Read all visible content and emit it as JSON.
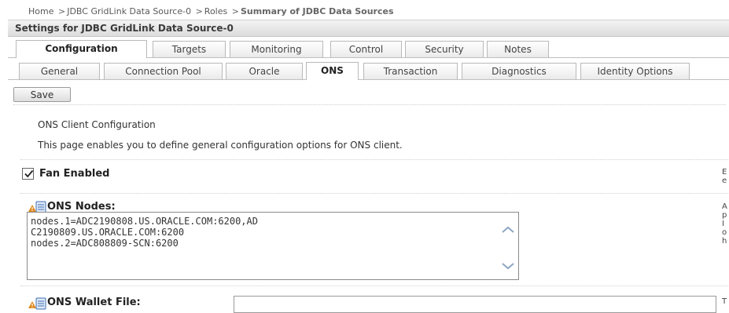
{
  "breadcrumb": {
    "items": [
      "Home",
      "JDBC GridLink Data Source-0",
      "Roles"
    ],
    "separator": ">",
    "current": "Summary of JDBC Data Sources"
  },
  "header": {
    "title": "Settings for JDBC GridLink Data Source-0"
  },
  "main_tabs": [
    {
      "label": "Configuration",
      "active": true
    },
    {
      "label": "Targets",
      "active": false
    },
    {
      "label": "Monitoring",
      "active": false
    },
    {
      "label": "Control",
      "active": false
    },
    {
      "label": "Security",
      "active": false
    },
    {
      "label": "Notes",
      "active": false
    }
  ],
  "sub_tabs": [
    {
      "label": "General",
      "active": false
    },
    {
      "label": "Connection Pool",
      "active": false
    },
    {
      "label": "Oracle",
      "active": false
    },
    {
      "label": "ONS",
      "active": true
    },
    {
      "label": "Transaction",
      "active": false
    },
    {
      "label": "Diagnostics",
      "active": false
    },
    {
      "label": "Identity Options",
      "active": false
    }
  ],
  "toolbar": {
    "save_label": "Save"
  },
  "section": {
    "title": "ONS Client Configuration",
    "description": "This page enables you to define general configuration options for ONS client."
  },
  "fields": {
    "fan_enabled": {
      "label": "Fan Enabled",
      "checked": true,
      "help": "E\ne"
    },
    "ons_nodes": {
      "label": "ONS Nodes:",
      "value": "nodes.1=ADC2190808.US.ORACLE.COM:6200,AD\nC2190809.US.ORACLE.COM:6200\nnodes.2=ADC808809-SCN:6200",
      "help": "A\np\nI\no\nh"
    },
    "ons_wallet_file": {
      "label": "ONS Wallet File:",
      "value": "",
      "help": "T"
    }
  },
  "colors": {
    "tab_border": "#b9b9b9",
    "icon_orange": "#e08a1e",
    "icon_blue": "#3f6fb5"
  }
}
